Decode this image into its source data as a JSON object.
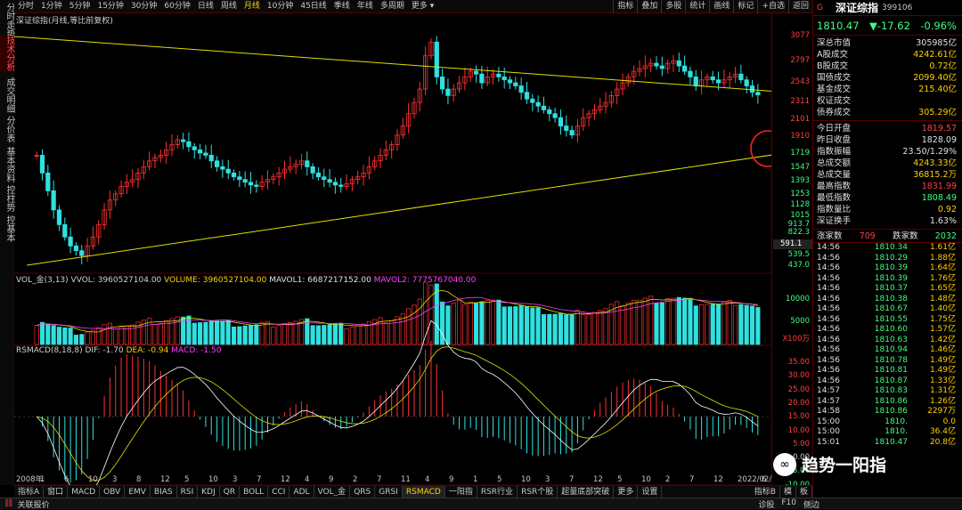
{
  "left_sidebar": [
    "分时走势",
    "技术分析",
    "成交明细",
    "分价表",
    "基本资料",
    "控柱势",
    "控基本"
  ],
  "left_sidebar_active": 1,
  "period_tabs": [
    "分时",
    "1分钟",
    "5分钟",
    "15分钟",
    "30分钟",
    "60分钟",
    "日线",
    "周线",
    "月线",
    "10分钟",
    "45日线",
    "季线",
    "年线",
    "多周期",
    "更多 ▾"
  ],
  "active_period": 8,
  "tools": [
    "指标",
    "叠加",
    "多股",
    "统计",
    "画线",
    "标记",
    "+自选",
    "返回"
  ],
  "main_legend": "深证综指(月线,等比前复权)",
  "y_ticks_main": [
    {
      "v": "3077",
      "c": "r"
    },
    {
      "v": "2797",
      "c": "r"
    },
    {
      "v": "2543",
      "c": "r"
    },
    {
      "v": "2311",
      "c": "r"
    },
    {
      "v": "2101",
      "c": "r"
    },
    {
      "v": "1910",
      "c": "r"
    },
    {
      "v": "1719",
      "c": "g"
    },
    {
      "v": "1547",
      "c": "g"
    },
    {
      "v": "1393",
      "c": "g"
    },
    {
      "v": "1253",
      "c": "g"
    },
    {
      "v": "1128",
      "c": "g"
    },
    {
      "v": "1015",
      "c": "g"
    },
    {
      "v": "913.7",
      "c": "g"
    },
    {
      "v": "822.3",
      "c": "g"
    },
    {
      "v": "539.5",
      "c": "g"
    },
    {
      "v": "437.0",
      "c": "g"
    }
  ],
  "current_price_label": "591.1",
  "vol_legend": {
    "name": "VOL_金(3,13)",
    "vvol": "VVOL: 3960527104.00",
    "volume": "VOLUME: 3960527104.00",
    "mavol1": "MAVOL1: 6687217152.00",
    "mavol2": "MAVOL2: 7775767040.00"
  },
  "vol_ticks": [
    "10000",
    "5000",
    "X100万"
  ],
  "macd_legend": {
    "name": "RSMACD(8,18,8)",
    "dif": "DIF: -1.70",
    "dea": "DEA: -0.94",
    "macd": "MACD: -1.50"
  },
  "macd_ticks": [
    "35.00",
    "30.00",
    "25.00",
    "20.00",
    "15.00",
    "10.00",
    "5.00",
    "0.00",
    "-5.00",
    "-10.00",
    "-15.00"
  ],
  "x_labels": [
    "2008年",
    "1",
    "6",
    "10",
    "3",
    "8",
    "12",
    "5",
    "10",
    "3",
    "7",
    "12",
    "4",
    "9",
    "2",
    "7",
    "11",
    "4",
    "9",
    "1",
    "5",
    "10",
    "3",
    "7",
    "12",
    "5",
    "10",
    "2",
    "7",
    "12",
    "2022/02/28/一",
    "6"
  ],
  "bottom_tabs": [
    "指标A",
    "窗口",
    "MACD",
    "OBV",
    "EMV",
    "BIAS",
    "RSI",
    "KDJ",
    "QR",
    "BOLL",
    "CCI",
    "ADL",
    "VOL_金",
    "QRS",
    "GRSI",
    "RSMACD",
    "一阳指",
    "RSR行业",
    "RSR个股",
    "超量底部突破",
    "更多",
    "设置"
  ],
  "active_bottom_tab": 15,
  "bottom_right": [
    "指标B",
    "模",
    "板"
  ],
  "status": {
    "left": "关联报价",
    "items": [
      "诊股",
      "F10",
      "侧边"
    ]
  },
  "right_panel": {
    "flag": "G",
    "name": "深证综指",
    "code": "399106",
    "price": "1810.47",
    "change": "▼-17.62",
    "pct": "-0.96%",
    "stats1": [
      {
        "l": "深总市值",
        "v": "305985亿",
        "c": "white"
      },
      {
        "l": "A股成交",
        "v": "4242.61亿",
        "c": "yellow"
      },
      {
        "l": "B股成交",
        "v": "0.72亿",
        "c": "yellow"
      },
      {
        "l": "国债成交",
        "v": "2099.40亿",
        "c": "yellow"
      },
      {
        "l": "基金成交",
        "v": "215.40亿",
        "c": "yellow"
      },
      {
        "l": "权证成交",
        "v": "",
        "c": "yellow"
      },
      {
        "l": "债券成交",
        "v": "305.29亿",
        "c": "yellow"
      }
    ],
    "stats2": [
      {
        "l": "今日开盘",
        "v": "1819.57",
        "c": "red"
      },
      {
        "l": "昨日收盘",
        "v": "1828.09",
        "c": "white"
      },
      {
        "l": "指数振幅",
        "v": "23.50/1.29%",
        "c": "white"
      },
      {
        "l": "总成交额",
        "v": "4243.33亿",
        "c": "yellow"
      },
      {
        "l": "总成交量",
        "v": "36815.2万",
        "c": "yellow"
      },
      {
        "l": "最高指数",
        "v": "1831.99",
        "c": "red"
      },
      {
        "l": "最低指数",
        "v": "1808.49",
        "c": "green"
      },
      {
        "l": "指数量比",
        "v": "0.92",
        "c": "yellow"
      },
      {
        "l": "深证换手",
        "v": "1.63%",
        "c": "white"
      }
    ],
    "updown": {
      "up_label": "涨家数",
      "up": "709",
      "down_label": "跌家数",
      "down": "2032"
    },
    "ticks": [
      [
        "14:56",
        "1810.34",
        "1.61亿"
      ],
      [
        "14:56",
        "1810.29",
        "1.88亿"
      ],
      [
        "14:56",
        "1810.39",
        "1.64亿"
      ],
      [
        "14:56",
        "1810.39",
        "1.76亿"
      ],
      [
        "14:56",
        "1810.37",
        "1.65亿"
      ],
      [
        "14:56",
        "1810.38",
        "1.48亿"
      ],
      [
        "14:56",
        "1810.67",
        "1.40亿"
      ],
      [
        "14:56",
        "1810.55",
        "1.75亿"
      ],
      [
        "14:56",
        "1810.60",
        "1.57亿"
      ],
      [
        "14:56",
        "1810.63",
        "1.42亿"
      ],
      [
        "14:56",
        "1810.94",
        "1.46亿"
      ],
      [
        "14:56",
        "1810.78",
        "1.49亿"
      ],
      [
        "14:56",
        "1810.81",
        "1.49亿"
      ],
      [
        "14:56",
        "1810.87",
        "1.33亿"
      ],
      [
        "14:57",
        "1810.83",
        "1.31亿"
      ],
      [
        "14:57",
        "1810.86",
        "1.26亿"
      ],
      [
        "14:58",
        "1810.86",
        "2297万"
      ],
      [
        "15:00",
        "1810.",
        "0.0"
      ],
      [
        "15:00",
        "1810.",
        "36.4亿"
      ],
      [
        "15:01",
        "1810.47",
        "20.8亿"
      ]
    ]
  },
  "watermark": "趋势一阳指",
  "chart_data": {
    "type": "candlestick",
    "title": "深证综指(月线,等比前复权)",
    "note": "approximate monthly closes from 2008 to 2022",
    "closes": [
      1100,
      950,
      820,
      700,
      620,
      560,
      520,
      500,
      480,
      520,
      560,
      620,
      700,
      760,
      800,
      850,
      880,
      900,
      950,
      1000,
      1050,
      1080,
      1100,
      1150,
      1200,
      1250,
      1230,
      1180,
      1150,
      1120,
      1100,
      1050,
      1000,
      980,
      950,
      920,
      900,
      880,
      860,
      850,
      880,
      900,
      920,
      950,
      980,
      1000,
      1020,
      1050,
      1000,
      950,
      920,
      900,
      880,
      860,
      850,
      870,
      900,
      920,
      950,
      1000,
      1050,
      1100,
      1150,
      1200,
      1300,
      1400,
      1550,
      1700,
      1900,
      2500,
      2800,
      2100,
      1900,
      1800,
      1900,
      2000,
      2100,
      2200,
      2150,
      2000,
      2100,
      2150,
      2100,
      2050,
      2000,
      1950,
      1850,
      1750,
      1700,
      1650,
      1600,
      1550,
      1500,
      1400,
      1350,
      1300,
      1400,
      1500,
      1550,
      1600,
      1650,
      1700,
      1800,
      1900,
      2000,
      2100,
      2200,
      2250,
      2300,
      2350,
      2300,
      2250,
      2350,
      2400,
      2300,
      2200,
      2100,
      1950,
      2050,
      2100,
      2050,
      2000,
      2050,
      2100,
      2150,
      2050,
      1950,
      1850,
      1810
    ]
  }
}
